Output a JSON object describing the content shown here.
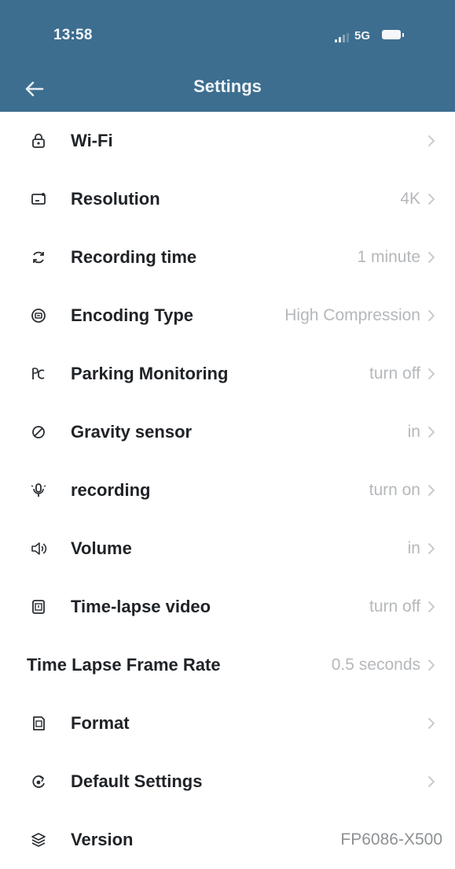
{
  "status_bar": {
    "time": "13:58",
    "network": "5G",
    "icons": [
      "signal-icon",
      "battery-icon"
    ]
  },
  "header": {
    "title": "Settings",
    "back_icon": "arrow-left-icon"
  },
  "colors": {
    "header_bg": "#3d6e8f",
    "text": "#1f2327",
    "muted": "#b5b8bb"
  },
  "settings": [
    {
      "icon": "lock-icon",
      "label": "Wi-Fi",
      "value": ""
    },
    {
      "icon": "screen-icon",
      "label": "Resolution",
      "value": "4K"
    },
    {
      "icon": "loop-icon",
      "label": "Recording time",
      "value": "1 minute"
    },
    {
      "icon": "encoding-icon",
      "label": "Encoding Type",
      "value": "High Compression"
    },
    {
      "icon": "parking-icon",
      "label": "Parking Monitoring",
      "value": "turn off"
    },
    {
      "icon": "gravity-icon",
      "label": "Gravity sensor",
      "value": "in"
    },
    {
      "icon": "microphone-icon",
      "label": "recording",
      "value": "turn on"
    },
    {
      "icon": "volume-icon",
      "label": "Volume",
      "value": "in"
    },
    {
      "icon": "timelapse-icon",
      "label": "Time-lapse video",
      "value": "turn off"
    },
    {
      "icon": "",
      "label": "Time Lapse Frame Rate",
      "value": "0.5 seconds"
    },
    {
      "icon": "sd-card-icon",
      "label": "Format",
      "value": ""
    },
    {
      "icon": "reset-icon",
      "label": "Default Settings",
      "value": ""
    },
    {
      "icon": "layers-icon",
      "label": "Version",
      "value": "FP6086-X500"
    }
  ]
}
